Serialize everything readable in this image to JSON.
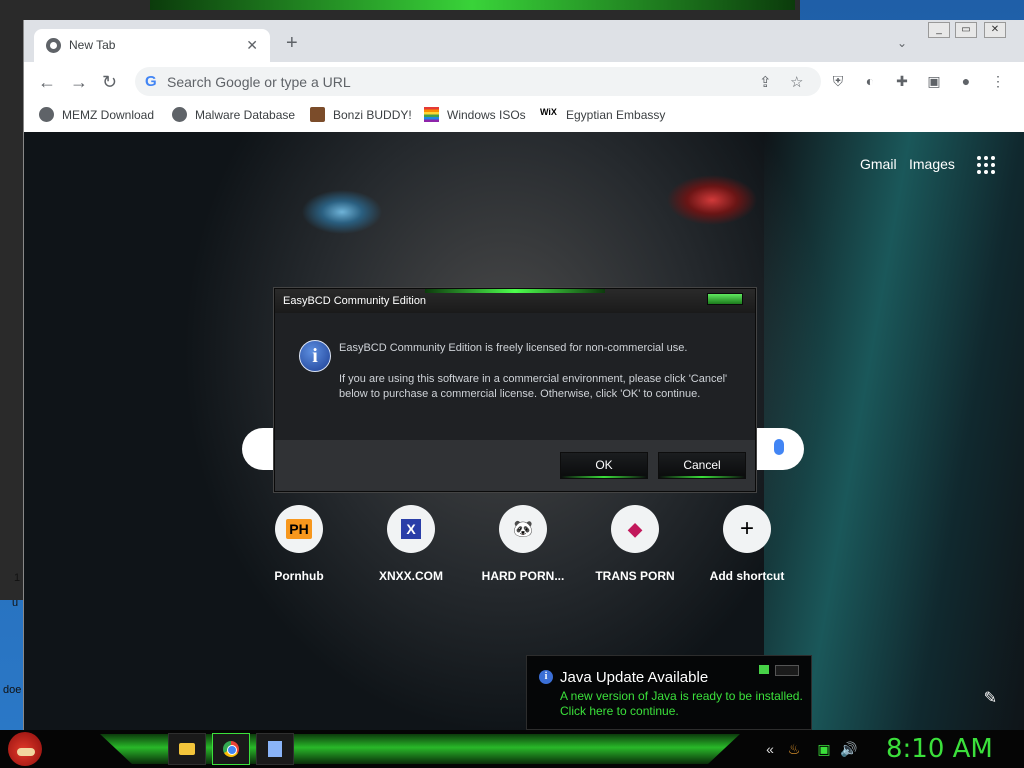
{
  "desktop": {
    "left_text_1": "u",
    "left_text_2": "doe",
    "left_text_3": "1"
  },
  "browser": {
    "tab_title": "New Tab",
    "tab_close": "✕",
    "new_tab": "+",
    "tab_search": "⌄",
    "omnibox_placeholder": "Search Google or type a URL",
    "bookmarks": [
      {
        "label": "MEMZ Download"
      },
      {
        "label": "Malware Database"
      },
      {
        "label": "Bonzi BUDDY!"
      },
      {
        "label": "Windows ISOs"
      },
      {
        "label": "Egyptian Embassy"
      }
    ]
  },
  "newtab": {
    "gmail": "Gmail",
    "images": "Images",
    "shortcuts": [
      {
        "label": "Pornhub",
        "icon_text": "PH",
        "icon_color": "#f7971d"
      },
      {
        "label": "XNXX.COM",
        "icon_text": "X",
        "icon_color": "#2a3ea8"
      },
      {
        "label": "HARD PORN...",
        "icon_text": "🐼",
        "icon_color": "#ffffff"
      },
      {
        "label": "TRANS PORN",
        "icon_text": "◆",
        "icon_color": "#c2185b"
      },
      {
        "label": "Add shortcut",
        "icon_text": "+",
        "icon_color": "#202124"
      }
    ]
  },
  "dialog": {
    "title": "EasyBCD Community Edition",
    "message_1": "EasyBCD Community Edition is freely licensed for non-commercial use.",
    "message_2": "If you are using this software in a commercial environment, please click 'Cancel' below to purchase a commercial license. Otherwise, click 'OK' to continue.",
    "ok": "OK",
    "cancel": "Cancel"
  },
  "java": {
    "title": "Java Update Available",
    "line1": "A new version of Java is ready to be installed.",
    "line2": "Click here to continue."
  },
  "taskbar": {
    "clock": "8:10 AM"
  },
  "colors": {
    "accent_green": "#3be03b",
    "dialog_bg": "#262626"
  }
}
